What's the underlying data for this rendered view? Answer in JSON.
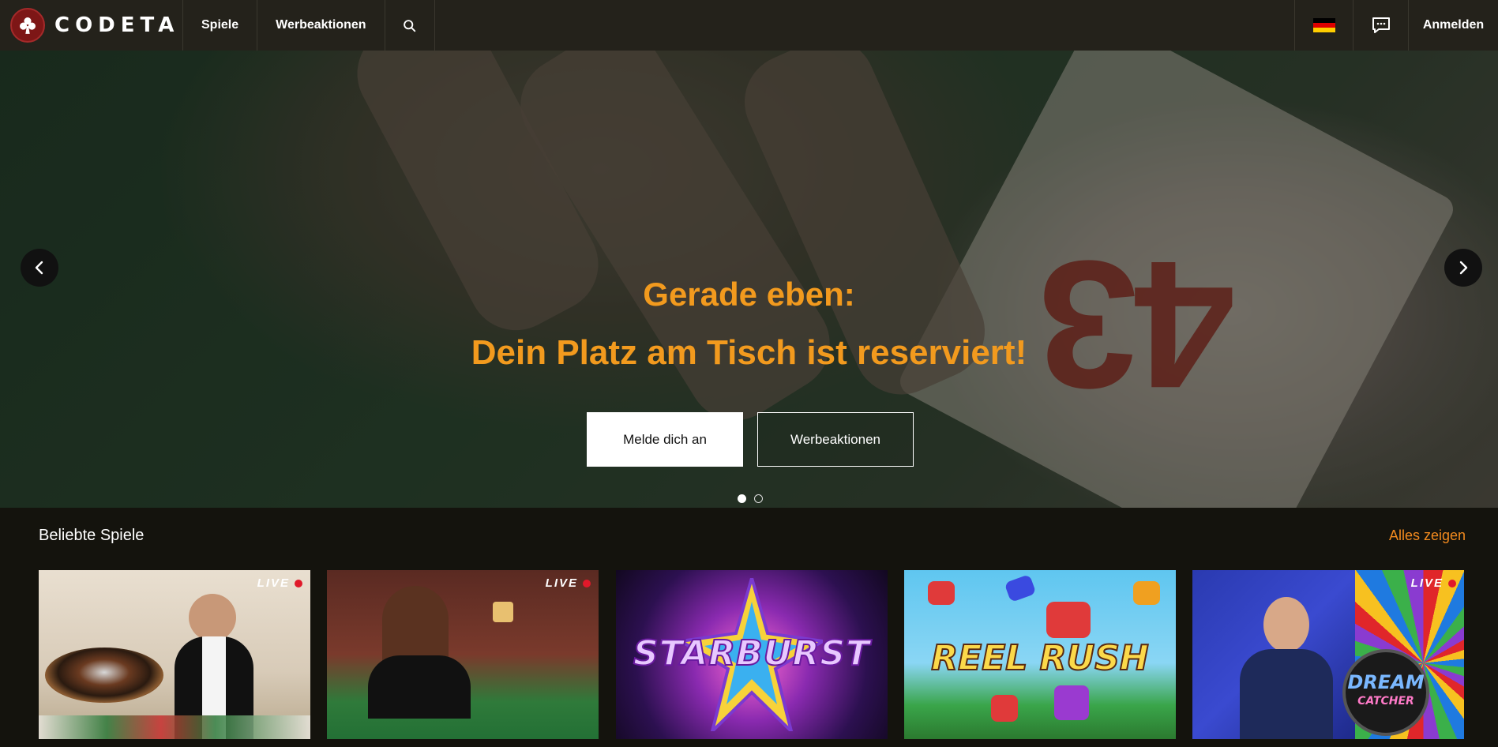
{
  "header": {
    "brand": "CODETA",
    "nav": [
      {
        "label": "Spiele"
      },
      {
        "label": "Werbeaktionen"
      }
    ],
    "login_label": "Anmelden",
    "language_flag": "de",
    "icons": [
      "club-icon",
      "search-icon",
      "chat-icon"
    ]
  },
  "hero": {
    "title_line1": "Gerade eben:",
    "title_line2": "Dein Platz am Tisch ist reserviert!",
    "primary_button": "Melde dich an",
    "secondary_button": "Werbeaktionen",
    "card_number": "43",
    "slides_total": 2,
    "active_slide": 1
  },
  "popular": {
    "title": "Beliebte Spiele",
    "see_all": "Alles zeigen",
    "games": [
      {
        "live": "LIVE"
      },
      {
        "live": "LIVE"
      },
      {
        "name": "STARBURST"
      },
      {
        "name": "REEL RUSH"
      },
      {
        "live": "LIVE",
        "name_line1": "DREAM",
        "name_line2": "CATCHER"
      }
    ]
  },
  "colors": {
    "accent_orange": "#f29a1e",
    "link_orange": "#f28a1e",
    "topbar": "#24221b",
    "page_bg": "#14130d",
    "logo_red": "#7d1616",
    "live_red": "#e0192a"
  }
}
